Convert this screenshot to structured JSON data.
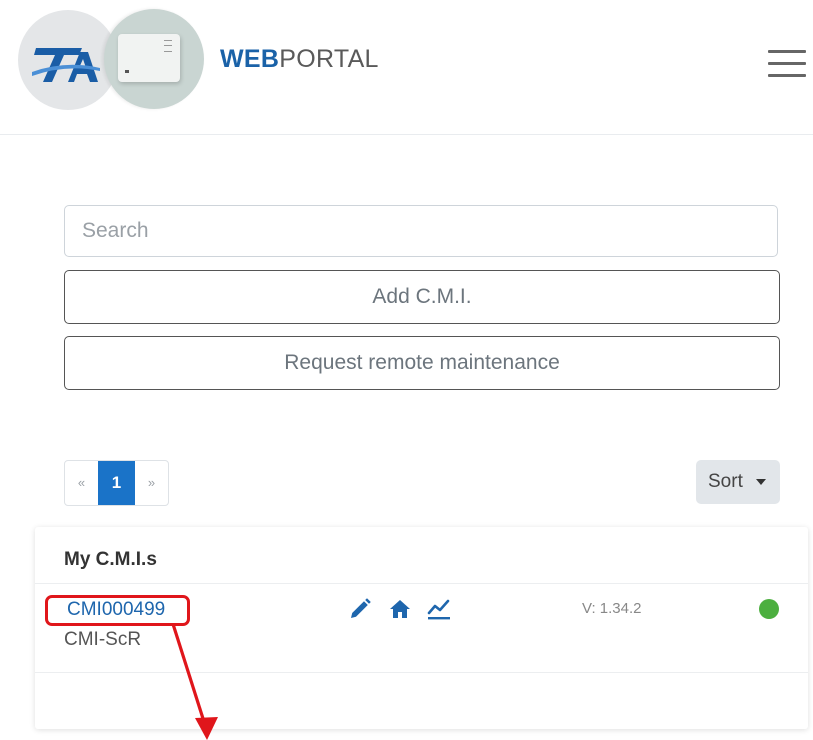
{
  "header": {
    "brand_bold": "WEB",
    "brand_regular": "PORTAL",
    "logo_text": "TA"
  },
  "form": {
    "search_placeholder": "Search",
    "add_button": "Add C.M.I.",
    "remote_button": "Request remote maintenance"
  },
  "pagination": {
    "prev": "«",
    "current": "1",
    "next": "»"
  },
  "sort": {
    "label": "Sort"
  },
  "card": {
    "title": "My C.M.I.s",
    "device": {
      "id": "CMI000499",
      "type": "CMI-ScR",
      "version": "V: 1.34.2",
      "actions": [
        "pencil-icon",
        "home-icon",
        "chart-line-icon"
      ],
      "status_color": "#4caf3f"
    }
  },
  "colors": {
    "accent": "#1a73c8",
    "link": "#1e66ad",
    "highlight": "#e0161b",
    "status_online": "#4caf3f"
  }
}
